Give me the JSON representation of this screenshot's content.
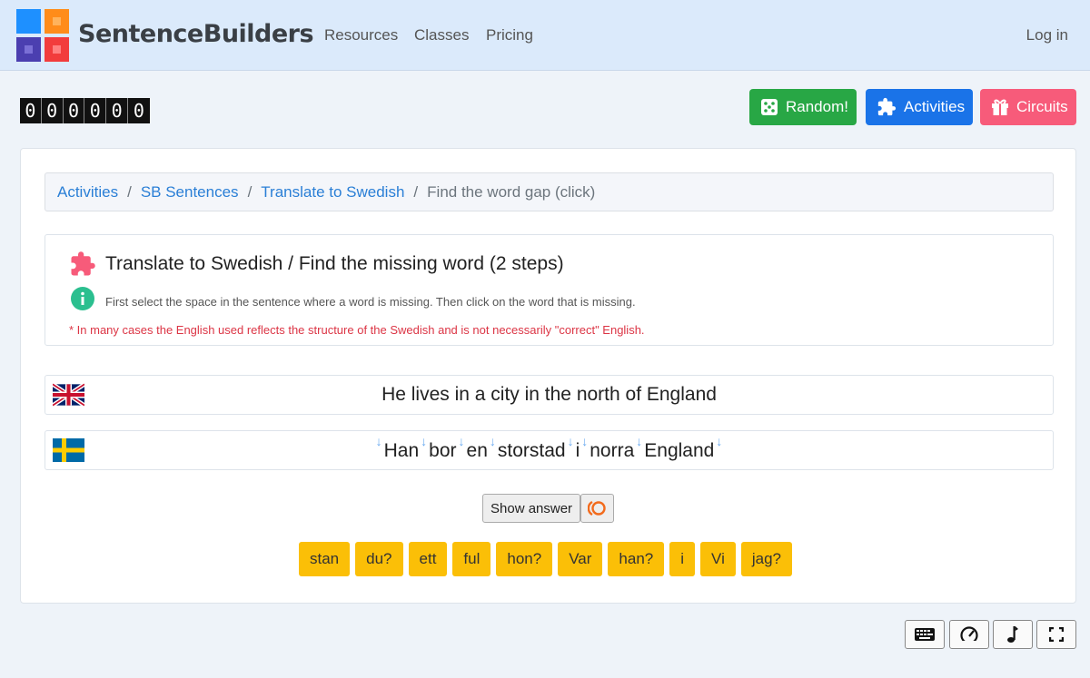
{
  "nav": {
    "brand": "SentenceBuilders",
    "links": [
      "Resources",
      "Classes",
      "Pricing"
    ],
    "login": "Log in"
  },
  "counter": [
    "0",
    "0",
    "0",
    "0",
    "0",
    "0"
  ],
  "buttons": {
    "random": "Random!",
    "activities": "Activities",
    "circuits": "Circuits"
  },
  "breadcrumb": {
    "items": [
      "Activities",
      "SB Sentences",
      "Translate to Swedish"
    ],
    "separator": "/",
    "current": "Find the word gap (click)"
  },
  "info": {
    "title": "Translate to Swedish / Find the missing word (2 steps)",
    "text": "First select the space in the sentence where a word is missing. Then click on the word that is missing.",
    "note": "* In many cases the English used reflects the structure of the Swedish and is not necessarily \"correct\" English."
  },
  "english_sentence": "He lives in a city in the north of England",
  "swedish_words": [
    "Han",
    "bor",
    "en",
    "storstad",
    "i",
    "norra",
    "England"
  ],
  "gap_marker": "↓",
  "show_answer": "Show answer",
  "word_choices": [
    "stan",
    "du?",
    "ett",
    "ful",
    "hon?",
    "Var",
    "han?",
    "i",
    "Vi",
    "jag?"
  ],
  "colors": {
    "random": "#28a745",
    "activities": "#1a73e8",
    "circuits": "#f75b7a",
    "word_tile": "#fbbf07",
    "link": "#2a7fd6",
    "note": "#dc3545"
  }
}
